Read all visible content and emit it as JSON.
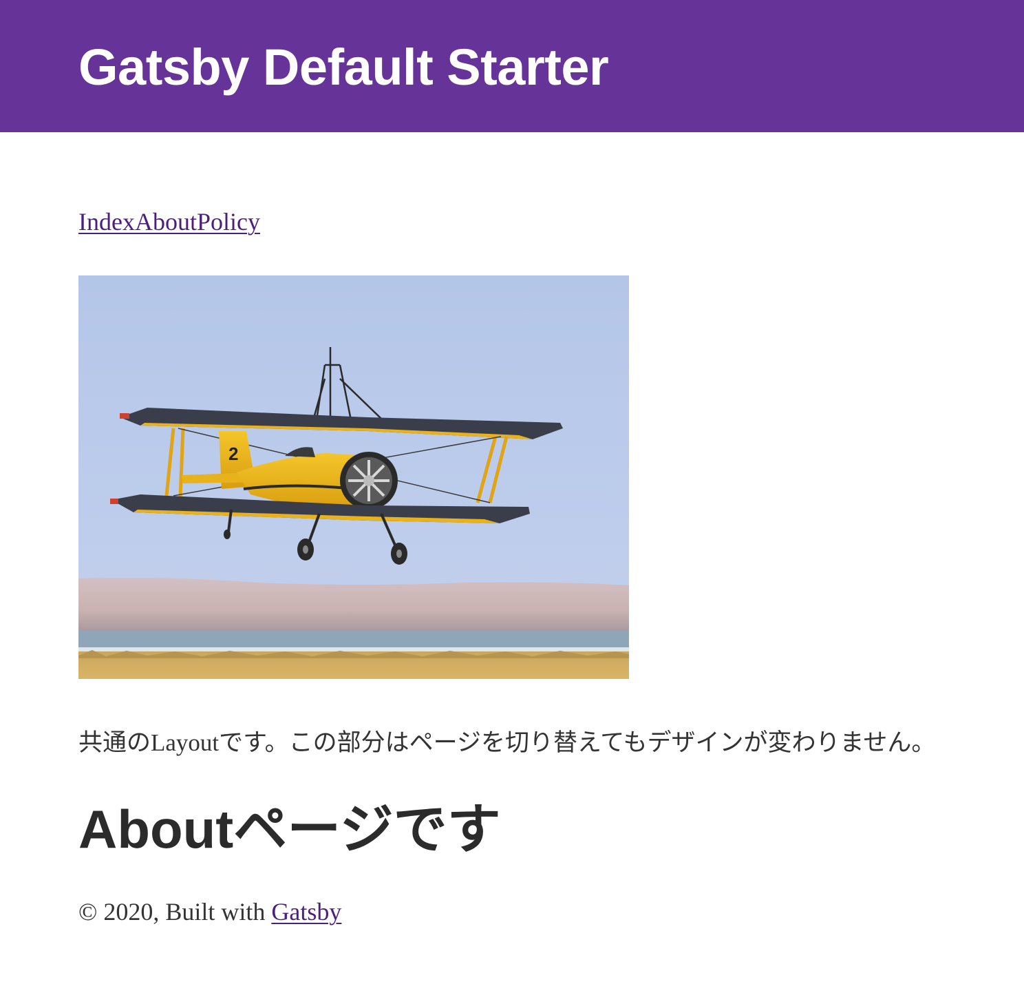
{
  "header": {
    "title": "Gatsby Default Starter"
  },
  "nav": {
    "links": [
      "Index",
      "About",
      "Policy"
    ]
  },
  "hero": {
    "alt": "yellow biplane in flight"
  },
  "layout": {
    "text": "共通のLayoutです。この部分はページを切り替えてもデザインが変わりません。"
  },
  "page": {
    "heading": "Aboutページです"
  },
  "footer": {
    "copyright": "© 2020, Built with ",
    "link": "Gatsby"
  },
  "colors": {
    "header_bg": "#663399",
    "link": "#4b1f7f"
  }
}
